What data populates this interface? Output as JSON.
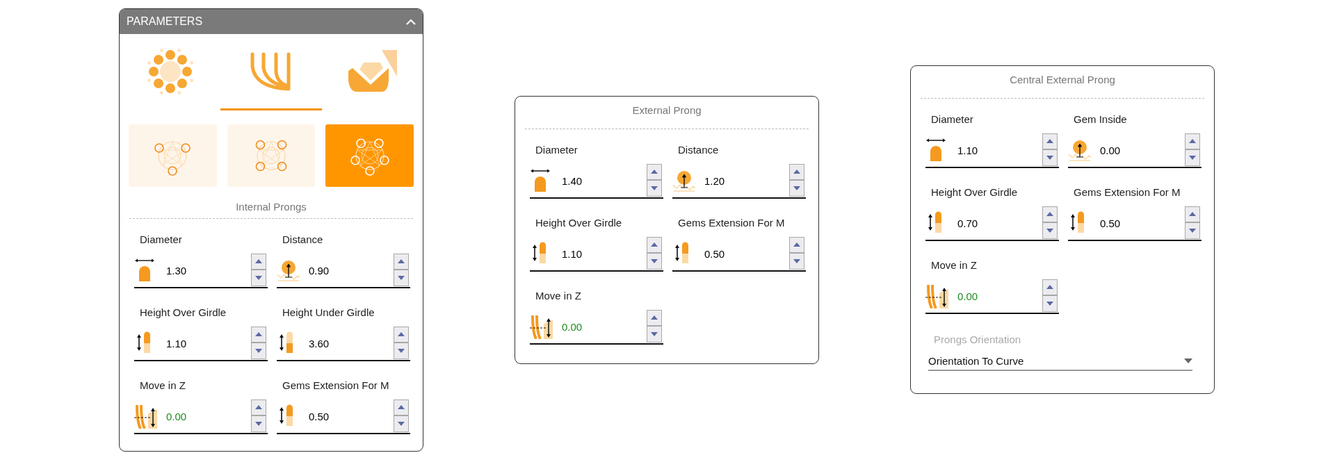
{
  "parameters_panel": {
    "title": "PARAMETERS",
    "expanded": true,
    "tabs": [
      {
        "kind": "gems",
        "selected": false
      },
      {
        "kind": "prongs",
        "selected": true
      },
      {
        "kind": "gallery",
        "selected": false
      }
    ],
    "layouts": [
      {
        "kind": "three",
        "selected": false
      },
      {
        "kind": "four",
        "selected": false
      },
      {
        "kind": "five",
        "selected": true
      }
    ],
    "section_title": "Internal Prongs",
    "fields": [
      {
        "kind": "diameter",
        "label": "Diameter",
        "value": "1.30",
        "color": "#000000"
      },
      {
        "kind": "distance",
        "label": "Distance",
        "value": "0.90",
        "color": "#000000"
      },
      {
        "kind": "height_over",
        "label": "Height Over Girdle",
        "value": "1.10",
        "color": "#000000"
      },
      {
        "kind": "height_under",
        "label": "Height Under Girdle",
        "value": "3.60",
        "color": "#000000"
      },
      {
        "kind": "move_z",
        "label": "Move in Z",
        "value": "0.00",
        "color": "#1e8c1e"
      },
      {
        "kind": "height_over",
        "label": "Gems Extension For M",
        "value": "0.50",
        "color": "#000000"
      }
    ]
  },
  "external_prong": {
    "title": "External Prong",
    "fields": [
      {
        "kind": "diameter",
        "label": "Diameter",
        "value": "1.40",
        "color": "#000000"
      },
      {
        "kind": "distance",
        "label": "Distance",
        "value": "1.20",
        "color": "#000000"
      },
      {
        "kind": "height_over",
        "label": "Height Over Girdle",
        "value": "1.10",
        "color": "#000000"
      },
      {
        "kind": "height_over",
        "label": "Gems Extension For M",
        "value": "0.50",
        "color": "#000000"
      },
      {
        "kind": "move_z",
        "label": "Move in Z",
        "value": "0.00",
        "color": "#1e8c1e"
      }
    ]
  },
  "central_external_prong": {
    "title": "Central External Prong",
    "fields": [
      {
        "kind": "diameter",
        "label": "Diameter",
        "value": "1.10",
        "color": "#000000"
      },
      {
        "kind": "distance",
        "label": "Gem Inside",
        "value": "0.00",
        "color": "#000000"
      },
      {
        "kind": "height_over",
        "label": "Height Over Girdle",
        "value": "0.70",
        "color": "#000000"
      },
      {
        "kind": "height_over",
        "label": "Gems Extension For M",
        "value": "0.50",
        "color": "#000000"
      },
      {
        "kind": "move_z",
        "label": "Move in Z",
        "value": "0.00",
        "color": "#1e8c1e"
      }
    ],
    "dropdown": {
      "label": "Prongs Orientation",
      "value": "Orientation To Curve"
    }
  }
}
